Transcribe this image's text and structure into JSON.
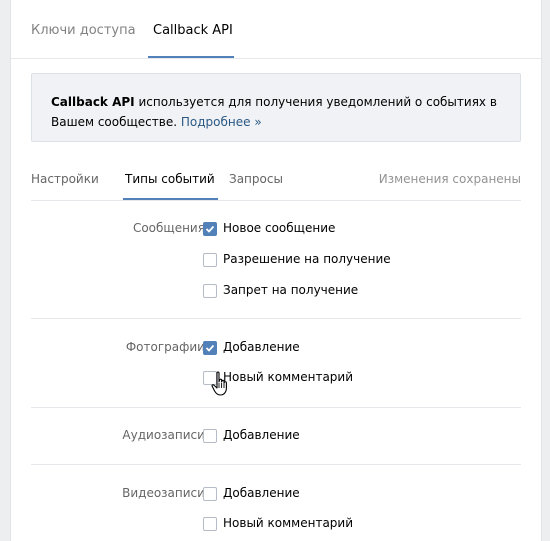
{
  "top_tabs": [
    {
      "label": "Ключи доступа",
      "active": false
    },
    {
      "label": "Callback API",
      "active": true
    }
  ],
  "info": {
    "bold": "Callback API",
    "text": " используется для получения уведомлений о событиях в Вашем сообществе.",
    "link": "Подробнее »"
  },
  "sub_tabs": [
    {
      "label": "Настройки",
      "active": false
    },
    {
      "label": "Типы событий",
      "active": true
    },
    {
      "label": "Запросы",
      "active": false
    }
  ],
  "status": "Изменения сохранены",
  "groups": [
    {
      "label": "Сообщения:",
      "options": [
        {
          "label": "Новое сообщение",
          "checked": true
        },
        {
          "label": "Разрешение на получение",
          "checked": false
        },
        {
          "label": "Запрет на получение",
          "checked": false
        }
      ]
    },
    {
      "label": "Фотографии:",
      "options": [
        {
          "label": "Добавление",
          "checked": true
        },
        {
          "label": "Новый комментарий",
          "checked": false
        }
      ]
    },
    {
      "label": "Аудиозаписи:",
      "options": [
        {
          "label": "Добавление",
          "checked": false
        }
      ]
    },
    {
      "label": "Видеозаписи:",
      "options": [
        {
          "label": "Добавление",
          "checked": false
        },
        {
          "label": "Новый комментарий",
          "checked": false
        }
      ]
    }
  ],
  "colors": {
    "accent": "#5181b8",
    "link": "#2a5885",
    "background": "#edeef0"
  }
}
